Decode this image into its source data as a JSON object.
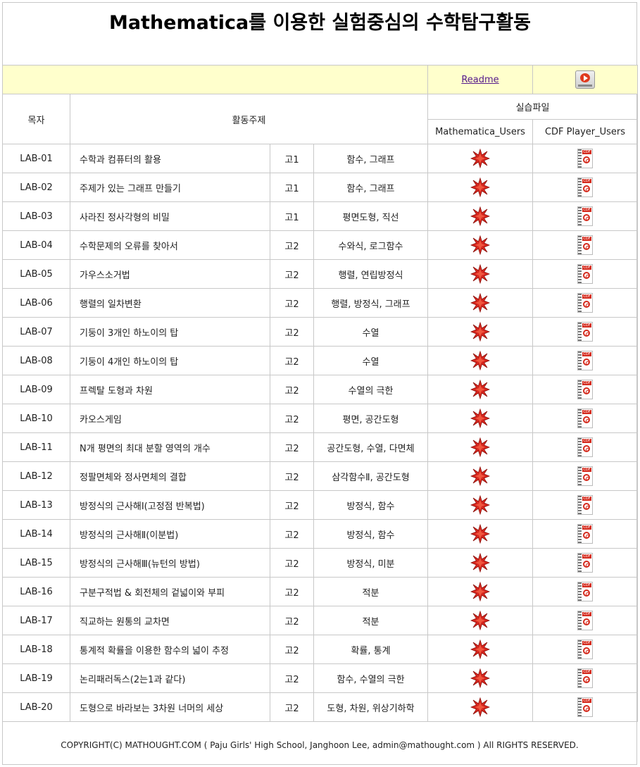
{
  "title": "Mathematica를 이용한 실험중심의 수학탐구활동",
  "toolbar": {
    "readme_label": "Readme",
    "play_icon": "play-media-icon"
  },
  "headers": {
    "index": "목자",
    "topic": "활동주제",
    "files": "실습파일",
    "mathematica": "Mathematica_Users",
    "cdf": "CDF Player_Users"
  },
  "rows": [
    {
      "id": "LAB-01",
      "topic": "수학과 컴퓨터의 활용",
      "grade": "고1",
      "subject": "함수, 그래프"
    },
    {
      "id": "LAB-02",
      "topic": "주제가 있는 그래프 만들기",
      "grade": "고1",
      "subject": "함수, 그래프"
    },
    {
      "id": "LAB-03",
      "topic": "사라진 정사각형의 비밀",
      "grade": "고1",
      "subject": "평면도형, 직선"
    },
    {
      "id": "LAB-04",
      "topic": "수학문제의 오류를 찾아서",
      "grade": "고2",
      "subject": "수와식, 로그함수"
    },
    {
      "id": "LAB-05",
      "topic": "가우스소거법",
      "grade": "고2",
      "subject": "행렬, 연립방정식"
    },
    {
      "id": "LAB-06",
      "topic": "행렬의 일차변환",
      "grade": "고2",
      "subject": "행렬, 방정식, 그래프"
    },
    {
      "id": "LAB-07",
      "topic": "기둥이 3개인 하노이의 탑",
      "grade": "고2",
      "subject": "수열"
    },
    {
      "id": "LAB-08",
      "topic": "기둥이 4개인 하노이의 탑",
      "grade": "고2",
      "subject": "수열"
    },
    {
      "id": "LAB-09",
      "topic": "프렉탈 도형과 차원",
      "grade": "고2",
      "subject": "수열의 극한"
    },
    {
      "id": "LAB-10",
      "topic": "카오스게임",
      "grade": "고2",
      "subject": "평면, 공간도형"
    },
    {
      "id": "LAB-11",
      "topic": "N개 평면의 최대 분할 영역의 개수",
      "grade": "고2",
      "subject": "공간도형, 수열, 다면체"
    },
    {
      "id": "LAB-12",
      "topic": "정팔면체와 정사면체의 결합",
      "grade": "고2",
      "subject": "삼각함수Ⅱ, 공간도형"
    },
    {
      "id": "LAB-13",
      "topic": "방정식의 근사해Ⅰ(고정점 반복법)",
      "grade": "고2",
      "subject": "방정식, 함수"
    },
    {
      "id": "LAB-14",
      "topic": "방정식의 근사해Ⅱ(이분법)",
      "grade": "고2",
      "subject": "방정식, 함수"
    },
    {
      "id": "LAB-15",
      "topic": "방정식의 근사해Ⅲ(뉴턴의 방법)",
      "grade": "고2",
      "subject": "방정식, 미분"
    },
    {
      "id": "LAB-16",
      "topic": "구분구적법 & 회전체의 겉넓이와 부피",
      "grade": "고2",
      "subject": "적분"
    },
    {
      "id": "LAB-17",
      "topic": "직교하는 원통의 교차면",
      "grade": "고2",
      "subject": "적분"
    },
    {
      "id": "LAB-18",
      "topic": "통계적 확률을 이용한 함수의 넓이 추정",
      "grade": "고2",
      "subject": "확률, 통계"
    },
    {
      "id": "LAB-19",
      "topic": "논리패러독스(2는1과 같다)",
      "grade": "고2",
      "subject": "함수, 수열의 극한"
    },
    {
      "id": "LAB-20",
      "topic": "도형으로 바라보는 3차원 너머의 세상",
      "grade": "고2",
      "subject": "도형, 차원, 위상기하학"
    }
  ],
  "icons": {
    "mathematica": "mathematica-star-icon",
    "cdf": "cdf-file-icon"
  },
  "colors": {
    "toolbar_bg": "#ffffcc",
    "border": "#c8c8c8",
    "star": "#d8261e",
    "link": "#551a8b"
  },
  "footer": "COPYRIGHT(C) MATHOUGHT.COM ( Paju Girls' High School, Janghoon Lee, admin@mathought.com ) All RIGHTS RESERVED."
}
